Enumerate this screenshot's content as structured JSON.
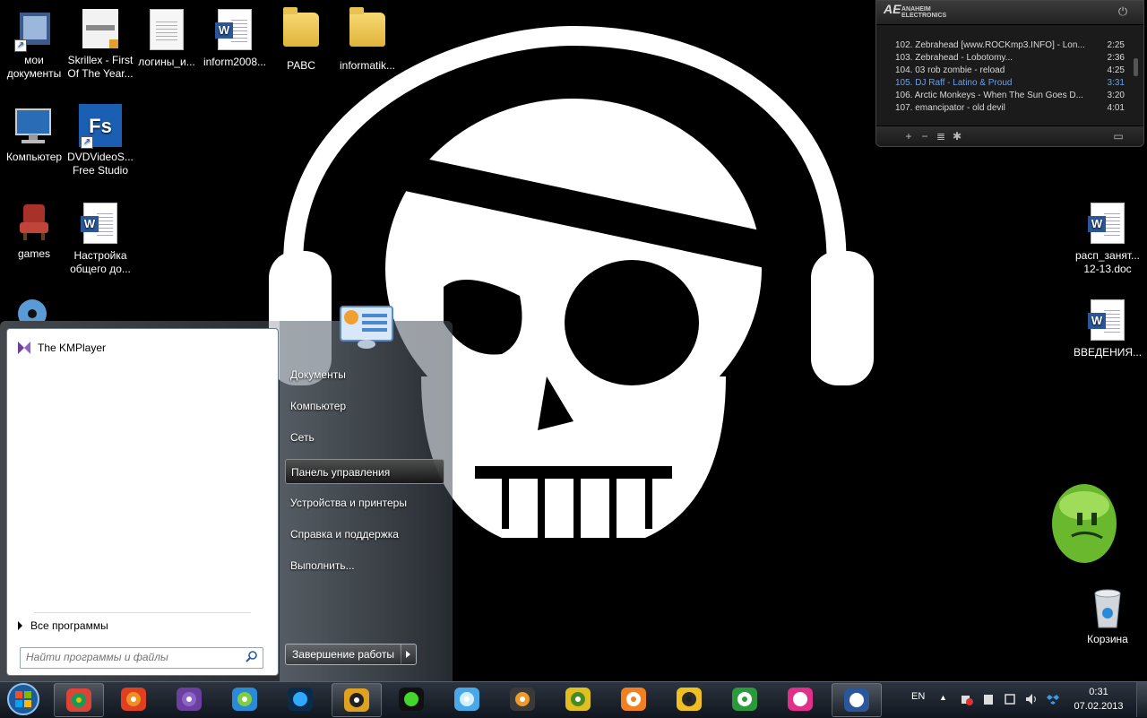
{
  "desktop": {
    "icons_left": [
      {
        "label": "мои документы",
        "name": "desktop-icon-my-documents"
      },
      {
        "label": "Skrillex - First Of The Year...",
        "name": "desktop-icon-skrillex"
      },
      {
        "label": "логины_и...",
        "name": "desktop-icon-logins"
      },
      {
        "label": "inform2008...",
        "name": "desktop-icon-inform2008"
      },
      {
        "label": "PABC",
        "name": "desktop-icon-pabc"
      },
      {
        "label": "informatik...",
        "name": "desktop-icon-informatik"
      },
      {
        "label": "Компьютер",
        "name": "desktop-icon-computer"
      },
      {
        "label": "DVDVideoS... Free Studio",
        "name": "desktop-icon-dvdvideosoft"
      },
      {
        "label": "games",
        "name": "desktop-icon-games"
      },
      {
        "label": "Настройка общего до...",
        "name": "desktop-icon-settings-doc"
      }
    ],
    "icons_right": [
      {
        "label": "расп_занят... 12-13.doc",
        "name": "desktop-icon-schedule"
      },
      {
        "label": "ВВЕДЕНИЯ...",
        "name": "desktop-icon-vvedeniya"
      },
      {
        "label": "Корзина",
        "name": "desktop-icon-recycle-bin"
      }
    ]
  },
  "player": {
    "logo_line1": "ANAHEIM",
    "logo_line2": "ELECTRONICS",
    "logo_mark": "AE",
    "tracks": [
      {
        "title": "102. Zebrahead [www.ROCKmp3.INFO] - Lon...",
        "duration": "2:25",
        "active": false
      },
      {
        "title": "103. Zebrahead - Lobotomy...",
        "duration": "2:36",
        "active": false
      },
      {
        "title": "104. 03 rob zombie - reload",
        "duration": "4:25",
        "active": false
      },
      {
        "title": "105. DJ Raff - Latino & Proud",
        "duration": "3:31",
        "active": true
      },
      {
        "title": "106. Arctic Monkeys - When The Sun Goes D...",
        "duration": "3:20",
        "active": false
      },
      {
        "title": "107. emancipator - old devil",
        "duration": "4:01",
        "active": false
      }
    ],
    "controls": {
      "add": "+",
      "remove": "−",
      "list": "≣",
      "settings": "✱"
    }
  },
  "start_menu": {
    "pinned_program": "The KMPlayer",
    "all_programs": "Все программы",
    "search_placeholder": "Найти программы и файлы",
    "right_links": [
      {
        "label": "Документы",
        "highlighted": false
      },
      {
        "label": "Компьютер",
        "highlighted": false
      },
      {
        "label": "Сеть",
        "highlighted": false
      },
      {
        "label": "Панель управления",
        "highlighted": true
      },
      {
        "label": "Устройства и принтеры",
        "highlighted": false
      },
      {
        "label": "Справка и поддержка",
        "highlighted": false
      },
      {
        "label": "Выполнить...",
        "highlighted": false
      }
    ],
    "shutdown_label": "Завершение работы"
  },
  "taskbar": {
    "apps": [
      "chrome",
      "burning-rom",
      "kmplayer",
      "navigator",
      "photoshop",
      "winamp",
      "razer",
      "itunes",
      "sublime",
      "game",
      "vlc",
      "hs",
      "utorrent",
      "winamp-alt",
      "word"
    ],
    "language": "EN",
    "time": "0:31",
    "date": "07.02.2013"
  },
  "colors": {
    "taskbar_top": "#2c3440",
    "taskbar_bottom": "#10161e",
    "player_active_track": "#6f9fe0",
    "start_left_bg": "#ffffff"
  }
}
